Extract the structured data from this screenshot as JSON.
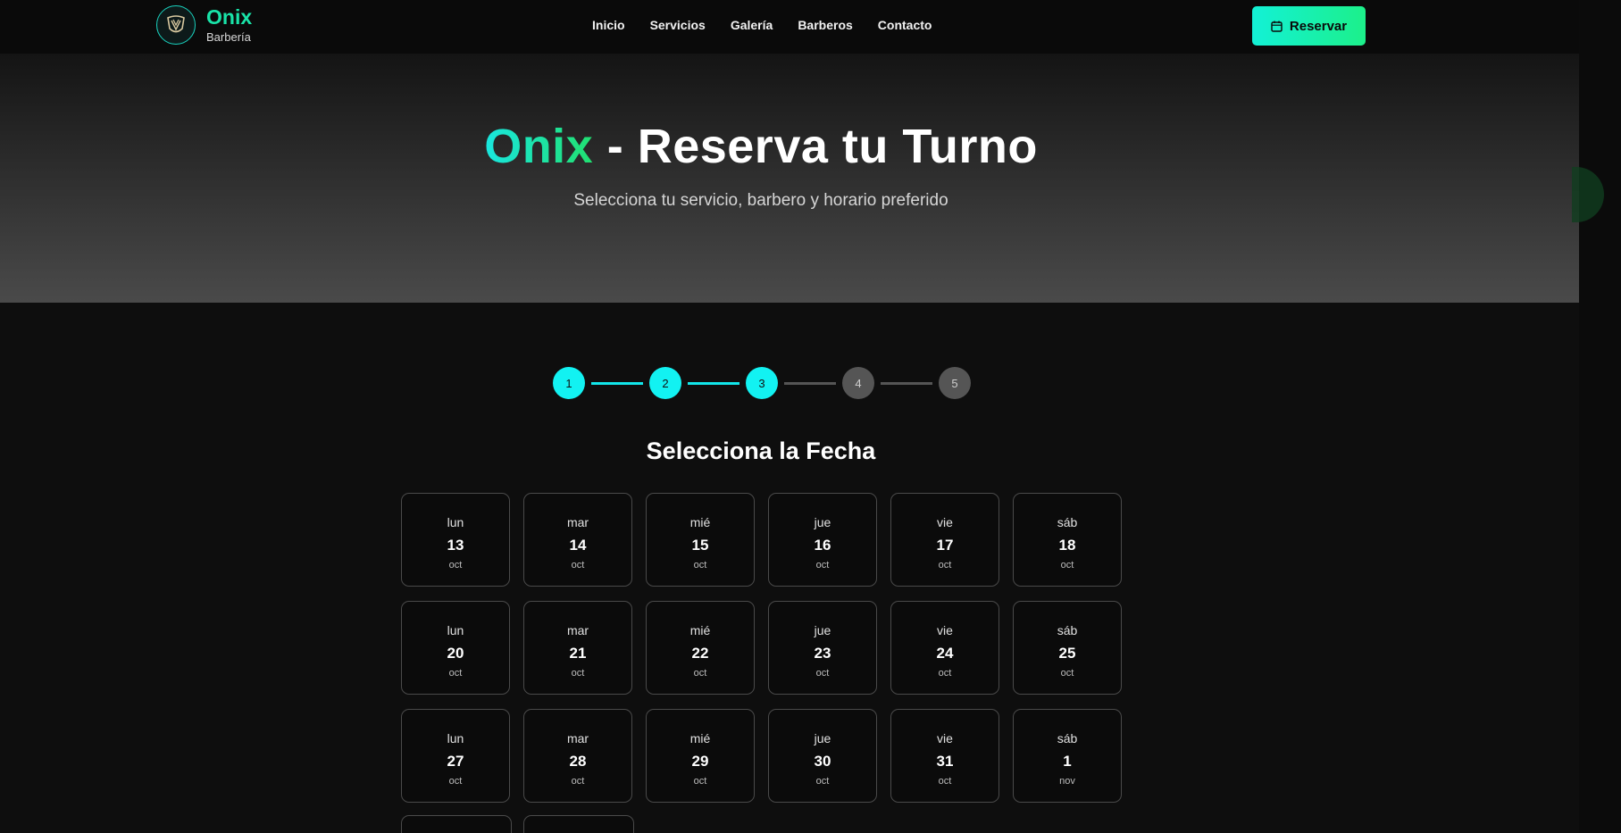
{
  "brand": {
    "name": "Onix",
    "subtitle": "Barbería"
  },
  "nav": {
    "items": [
      "Inicio",
      "Servicios",
      "Galería",
      "Barberos",
      "Contacto"
    ]
  },
  "header": {
    "reserve_label": "Reservar",
    "reserve_icon": "calendar-icon"
  },
  "hero": {
    "title_accent": "Onix",
    "title_rest": " - Reserva tu Turno",
    "subtitle": "Selecciona tu servicio, barbero y horario preferido"
  },
  "stepper": {
    "steps": [
      "1",
      "2",
      "3",
      "4",
      "5"
    ],
    "current": 3
  },
  "section": {
    "title": "Selecciona la Fecha"
  },
  "dates": [
    {
      "dow": "lun",
      "day": "13",
      "mon": "oct"
    },
    {
      "dow": "mar",
      "day": "14",
      "mon": "oct"
    },
    {
      "dow": "mié",
      "day": "15",
      "mon": "oct"
    },
    {
      "dow": "jue",
      "day": "16",
      "mon": "oct"
    },
    {
      "dow": "vie",
      "day": "17",
      "mon": "oct"
    },
    {
      "dow": "sáb",
      "day": "18",
      "mon": "oct"
    },
    {
      "dow": "lun",
      "day": "20",
      "mon": "oct"
    },
    {
      "dow": "mar",
      "day": "21",
      "mon": "oct"
    },
    {
      "dow": "mié",
      "day": "22",
      "mon": "oct"
    },
    {
      "dow": "jue",
      "day": "23",
      "mon": "oct"
    },
    {
      "dow": "vie",
      "day": "24",
      "mon": "oct"
    },
    {
      "dow": "sáb",
      "day": "25",
      "mon": "oct"
    },
    {
      "dow": "lun",
      "day": "27",
      "mon": "oct"
    },
    {
      "dow": "mar",
      "day": "28",
      "mon": "oct"
    },
    {
      "dow": "mié",
      "day": "29",
      "mon": "oct"
    },
    {
      "dow": "jue",
      "day": "30",
      "mon": "oct"
    },
    {
      "dow": "vie",
      "day": "31",
      "mon": "oct"
    },
    {
      "dow": "sáb",
      "day": "1",
      "mon": "nov"
    }
  ],
  "colors": {
    "accent": "#19e3a8",
    "step_active": "#12f2f2",
    "step_inactive": "#555555"
  }
}
